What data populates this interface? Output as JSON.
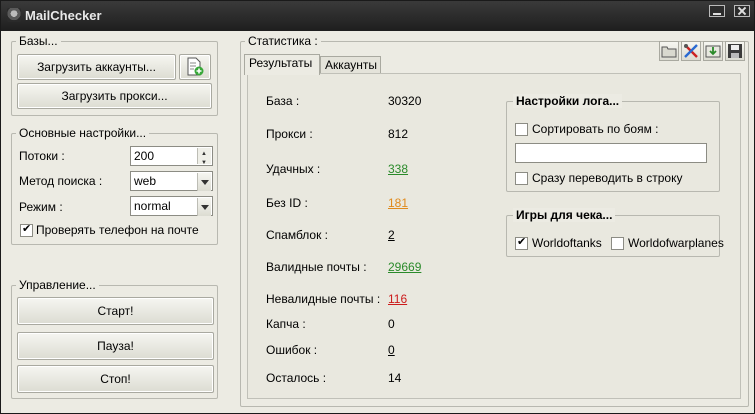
{
  "window": {
    "title": "MailChecker"
  },
  "bases": {
    "legend": "Базы...",
    "load_accounts_label": "Загрузить аккаунты...",
    "load_proxy_label": "Загрузить прокси..."
  },
  "settings": {
    "legend": "Основные настройки...",
    "threads_label": "Потоки :",
    "threads_value": "200",
    "search_method_label": "Метод поиска :",
    "search_method_value": "web",
    "mode_label": "Режим  :",
    "mode_value": "normal",
    "check_phone_label": "Проверять телефон на почте",
    "check_phone_checked": true
  },
  "control": {
    "legend": "Управление...",
    "start_label": "Старт!",
    "pause_label": "Пауза!",
    "stop_label": "Стоп!"
  },
  "stats": {
    "legend": "Статистика :",
    "tabs": [
      {
        "label": "Результаты",
        "active": true
      },
      {
        "label": "Аккаунты",
        "active": false
      }
    ],
    "rows": [
      {
        "label": "База :",
        "value": "30320"
      },
      {
        "label": "Прокси :",
        "value": "812"
      },
      {
        "label": "Удачных :",
        "value": "338"
      },
      {
        "label": "Без ID :",
        "value": "181"
      },
      {
        "label": "Спамблок :",
        "value": "2"
      },
      {
        "label": "Валидные почты :",
        "value": "29669"
      },
      {
        "label": "Невалидные почты :",
        "value": "116"
      },
      {
        "label": "Капча :",
        "value": "0"
      },
      {
        "label": "Ошибок :",
        "value": "0"
      },
      {
        "label": "Осталось :",
        "value": "14"
      }
    ]
  },
  "log_settings": {
    "legend": "Настройки лога...",
    "sort_by_battles_label": "Сортировать по боям :",
    "sort_by_battles_checked": false,
    "sort_value": "",
    "to_line_label": "Сразу переводить в строку",
    "to_line_checked": false
  },
  "games": {
    "legend": "Игры для чека...",
    "items": [
      {
        "label": "Worldoftanks",
        "checked": true
      },
      {
        "label": "Worldofwarplanes",
        "checked": false
      }
    ]
  },
  "colors": {
    "good": "#2a8a2a",
    "warn": "#e08a1c",
    "bad": "#cc1c1c"
  }
}
